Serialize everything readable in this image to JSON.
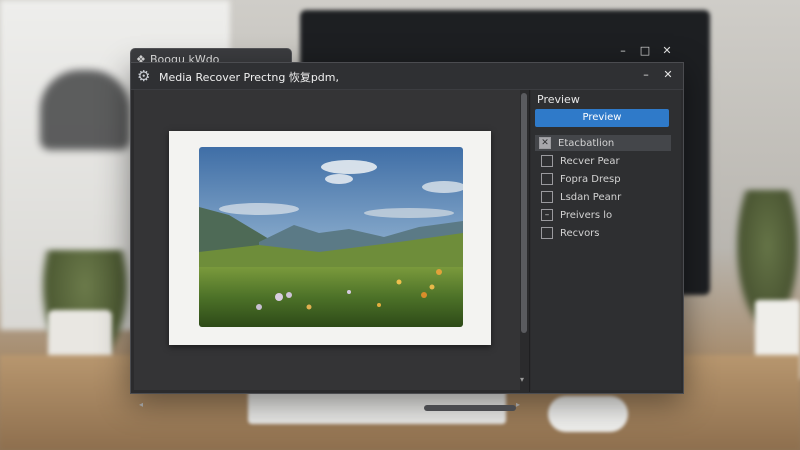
{
  "back_window": {
    "title": "Boogu kWdo"
  },
  "main_window": {
    "title": "Media Recover Prectng 恢复pdm,",
    "controls": {
      "minimize": "–",
      "maximize": "□",
      "close": "✕"
    }
  },
  "back_controls": {
    "minimize": "–",
    "maximize": "□",
    "close": "✕"
  },
  "panel": {
    "title": "Preview",
    "preview_button": "Preview",
    "options": [
      {
        "label": "Etacbatlion",
        "checked": true,
        "selected": true
      },
      {
        "label": "Recver Pear",
        "checked": false,
        "selected": false
      },
      {
        "label": "Fopra Dresp",
        "checked": false,
        "selected": false
      },
      {
        "label": "Lsdan Peanr",
        "checked": false,
        "selected": false
      },
      {
        "label": "Preivers lo",
        "checked": true,
        "selected": false
      },
      {
        "label": "Recvors",
        "checked": false,
        "selected": false
      }
    ]
  },
  "icons": {
    "app": "gear-icon",
    "back_app": "app-icon"
  },
  "colors": {
    "accent": "#2f7ac9",
    "window_bg": "#2b2b2d",
    "panel_bg": "#2e2f31"
  }
}
